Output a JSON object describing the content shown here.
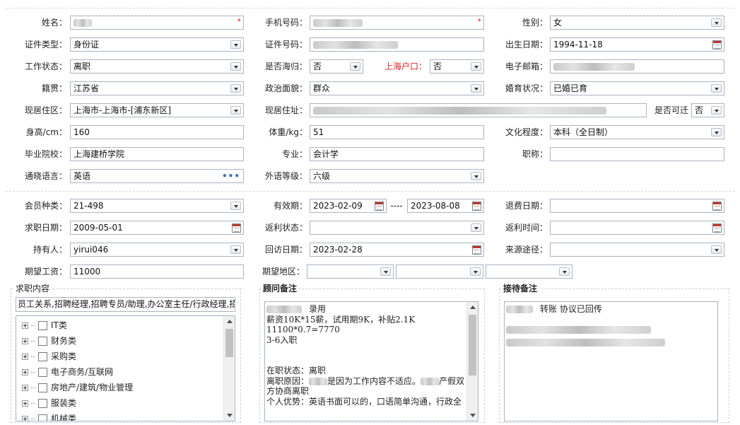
{
  "basic": {
    "name": {
      "label": "姓名："
    },
    "phone": {
      "label": "手机号码："
    },
    "gender": {
      "label": "性别：",
      "value": "女"
    },
    "id_type": {
      "label": "证件类型：",
      "value": "身份证"
    },
    "id_number": {
      "label": "证件号码："
    },
    "birth": {
      "label": "出生日期：",
      "value": "1994-11-18"
    },
    "work_status": {
      "label": "工作状态：",
      "value": "离职"
    },
    "returnee": {
      "label": "是否海归：",
      "value": "否"
    },
    "sh_hukou": {
      "label": "上海户口：",
      "value": "否"
    },
    "email": {
      "label": "电子邮箱："
    },
    "native": {
      "label": "籍贯：",
      "value": "江苏省"
    },
    "political": {
      "label": "政治面貌：",
      "value": "群众"
    },
    "marital": {
      "label": "婚育状况：",
      "value": "已婚已育"
    },
    "residence_area": {
      "label": "现居住区：",
      "value": "上海市-上海市-[浦东新区]"
    },
    "residence_addr": {
      "label": "现居住址："
    },
    "relocate": {
      "label": "是否可迁",
      "value": "否"
    },
    "height": {
      "label": "身高/cm：",
      "value": "160"
    },
    "weight": {
      "label": "体重/kg：",
      "value": "51"
    },
    "education": {
      "label": "文化程度：",
      "value": "本科（全日制）"
    },
    "school": {
      "label": "毕业院校：",
      "value": "上海建桥学院"
    },
    "major": {
      "label": "专业：",
      "value": "会计学"
    },
    "title": {
      "label": "职称：",
      "value": ""
    },
    "language": {
      "label": "通晓语言：",
      "value": "英语"
    },
    "foreign_level": {
      "label": "外语等级：",
      "value": "六级"
    }
  },
  "member": {
    "member_type": {
      "label": "会员种类：",
      "value": "21-498"
    },
    "valid": {
      "label": "有效期：",
      "from": "2023-02-09",
      "sep": "----",
      "to": "2023-08-08"
    },
    "refund_date": {
      "label": "退费日期：",
      "value": ""
    },
    "job_date": {
      "label": "求职日期：",
      "value": "2009-05-01"
    },
    "rebate_status": {
      "label": "返利状态：",
      "value": ""
    },
    "rebate_time": {
      "label": "返利时间：",
      "value": ""
    },
    "holder": {
      "label": "持有人：",
      "value": "yirui046"
    },
    "visit_date": {
      "label": "回访日期：",
      "value": "2023-02-28"
    },
    "source": {
      "label": "来源途径：",
      "value": ""
    },
    "expected_salary": {
      "label": "期望工资：",
      "value": "11000"
    },
    "expected_region": {
      "label": "期望地区：",
      "values": [
        "",
        "",
        ""
      ]
    }
  },
  "job_content": {
    "title": "求职内容",
    "summary": "员工关系,招聘经理,招聘专员/助理,办公室主任/行政经理,招",
    "categories": [
      "IT类",
      "财务类",
      "采购类",
      "电子商务/互联网",
      "房地产/建筑/物业管理",
      "服装类",
      "机械类"
    ]
  },
  "advisor_notes": {
    "title": "顾问备注",
    "lines": [
      "录用",
      "薪资10K*15薪，试用期9K，补贴2.1K",
      "11100*0.7=7770",
      "3-6入职",
      "",
      "",
      "在职状态：离职",
      "离职原因：",
      "是因为工作内容不适应。",
      "产假双",
      "方协商离职",
      "个人优势：英语书面可以的，口语简单沟通，行政全"
    ]
  },
  "reception_notes": {
    "title": "接待备注",
    "line1": "转账 协议已回传"
  },
  "icons": {
    "dropdown": "chevron-down-icon",
    "calendar": "calendar-icon",
    "more": "ellipsis-icon"
  },
  "colors": {
    "required": "#e02020",
    "border": "#a8b4c4"
  }
}
